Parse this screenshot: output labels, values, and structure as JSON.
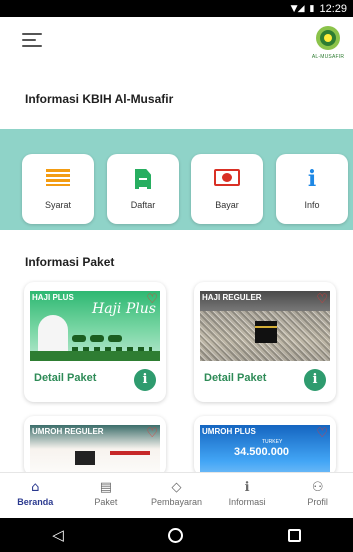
{
  "status_bar": {
    "time": "12:29",
    "signal_icon": "signal-icon",
    "battery_icon": "battery-icon"
  },
  "app_bar": {
    "menu_icon": "hamburger-menu-icon",
    "logo_text": "AL-MUSAFIR"
  },
  "page_title": "Informasi KBIH Al-Musafir",
  "quick_menu": [
    {
      "label": "Syarat",
      "icon": "list-icon",
      "color": "#f39c12"
    },
    {
      "label": "Daftar",
      "icon": "document-icon",
      "color": "#27ae60"
    },
    {
      "label": "Bayar",
      "icon": "money-icon",
      "color": "#d93025"
    },
    {
      "label": "Info",
      "icon": "info-icon",
      "color": "#1e88e5"
    }
  ],
  "section_title": "Informasi Paket",
  "packages": [
    {
      "tag": "HAJI PLUS",
      "poster_script": "Haji Plus",
      "link": "Detail Paket"
    },
    {
      "tag": "HAJI REGULER",
      "link": "Detail Paket"
    },
    {
      "tag": "UMROH REGULER"
    },
    {
      "tag": "UMROH PLUS",
      "poster_country": "TURKEY",
      "poster_price": "34.500.000"
    }
  ],
  "bottom_nav": [
    {
      "label": "Beranda",
      "icon": "home-icon",
      "active": true
    },
    {
      "label": "Paket",
      "icon": "briefcase-icon",
      "active": false
    },
    {
      "label": "Pembayaran",
      "icon": "payment-icon",
      "active": false
    },
    {
      "label": "Informasi",
      "icon": "info-icon",
      "active": false
    },
    {
      "label": "Profil",
      "icon": "person-icon",
      "active": false
    }
  ],
  "colors": {
    "accent": "#8fd3c8",
    "primary_green": "#2e8b57",
    "nav_active": "#2b3a8f",
    "heart": "#e53935"
  }
}
